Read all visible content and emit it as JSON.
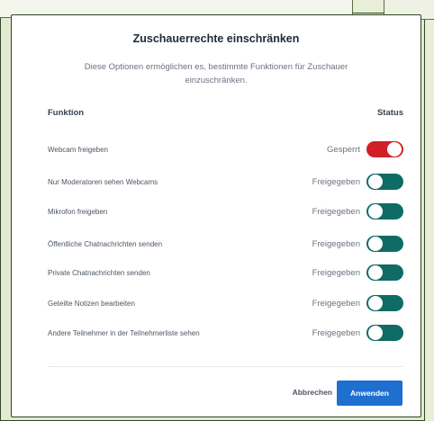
{
  "dialog": {
    "title": "Zuschauerrechte einschränken",
    "description": "Diese Optionen ermöglichen es, bestimmte Funktionen für Zuschauer einzuschränken.",
    "header_function": "Funktion",
    "header_status": "Status",
    "rows": [
      {
        "label": "Webcam freigeben",
        "status": "Gesperrt",
        "locked": true
      },
      {
        "label": "Nur Moderatoren sehen Webcams",
        "status": "Freigegeben",
        "locked": false
      },
      {
        "label": "Mikrofon freigeben",
        "status": "Freigegeben",
        "locked": false
      },
      {
        "label": "Öffentliche Chatnachrichten senden",
        "status": "Freigegeben",
        "locked": false
      },
      {
        "label": "Private Chatnachrichten senden",
        "status": "Freigegeben",
        "locked": false
      },
      {
        "label": "Geteilte Notizen bearbeiten",
        "status": "Freigegeben",
        "locked": false
      },
      {
        "label": "Andere Teilnehmer in der Teilnehmerliste sehen",
        "status": "Freigegeben",
        "locked": false
      }
    ],
    "cancel_label": "Abbrechen",
    "apply_label": "Anwenden"
  },
  "colors": {
    "locked": "#d11f26",
    "unlocked": "#0f6b66",
    "primary": "#1e6fd0"
  }
}
